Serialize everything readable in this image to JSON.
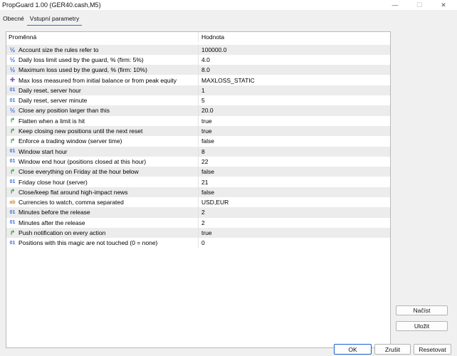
{
  "window": {
    "title": "PropGuard 1.00 (GER40.cash,M5)",
    "minimize_glyph": "—",
    "maximize_glyph": "☐",
    "close_glyph": "✕"
  },
  "tabs": [
    {
      "label": "Obecné",
      "active": false
    },
    {
      "label": "Vstupní parametry",
      "active": true
    }
  ],
  "grid": {
    "col_name": "Proměnná",
    "col_value": "Hodnota",
    "rows": [
      {
        "type": "frac",
        "icon": "½",
        "name": "Account size the rules refer to",
        "value": "100000.0"
      },
      {
        "type": "frac",
        "icon": "½",
        "name": "Daily loss limit used by the guard, % (firm: 5%)",
        "value": "4.0"
      },
      {
        "type": "frac",
        "icon": "½",
        "name": "Maximum loss used by the guard, % (firm: 10%)",
        "value": "8.0"
      },
      {
        "type": "enum",
        "icon": "✚",
        "name": "Max loss measured from initial balance or from peak equity",
        "value": "MAXLOSS_STATIC"
      },
      {
        "type": "int",
        "icon": "01",
        "name": "Daily reset, server hour",
        "value": "1"
      },
      {
        "type": "int",
        "icon": "01",
        "name": "Daily reset, server minute",
        "value": "5"
      },
      {
        "type": "frac",
        "icon": "½",
        "name": "Close any position larger than this",
        "value": "20.0"
      },
      {
        "type": "bool",
        "icon": "↱",
        "name": "Flatten when a limit is hit",
        "value": "true"
      },
      {
        "type": "bool",
        "icon": "↱",
        "name": "Keep closing new positions until the next reset",
        "value": "true"
      },
      {
        "type": "bool",
        "icon": "↱",
        "name": "Enforce a trading window (server time)",
        "value": "false"
      },
      {
        "type": "int",
        "icon": "01",
        "name": "Window start hour",
        "value": "8"
      },
      {
        "type": "int",
        "icon": "01",
        "name": "Window end hour (positions closed at this hour)",
        "value": "22"
      },
      {
        "type": "bool",
        "icon": "↱",
        "name": "Close everything on Friday at the hour below",
        "value": "false"
      },
      {
        "type": "int",
        "icon": "01",
        "name": "Friday close hour (server)",
        "value": "21"
      },
      {
        "type": "bool",
        "icon": "↱",
        "name": "Close/keep flat around high-impact news",
        "value": "false"
      },
      {
        "type": "str",
        "icon": "ab",
        "name": "Currencies to watch, comma separated",
        "value": "USD,EUR"
      },
      {
        "type": "int",
        "icon": "01",
        "name": "Minutes before the release",
        "value": "2"
      },
      {
        "type": "int",
        "icon": "01",
        "name": "Minutes after the release",
        "value": "2"
      },
      {
        "type": "bool",
        "icon": "↱",
        "name": "Push notification on every action",
        "value": "true"
      },
      {
        "type": "int",
        "icon": "01",
        "name": "Positions with this magic are not touched (0 = none)",
        "value": "0"
      }
    ]
  },
  "buttons": {
    "load": "Načíst",
    "save": "Uložit",
    "ok": "OK",
    "cancel": "Zrušit",
    "reset": "Resetovat"
  },
  "colors": {
    "accent": "#1a73e8",
    "row_alt": "#ececec"
  }
}
